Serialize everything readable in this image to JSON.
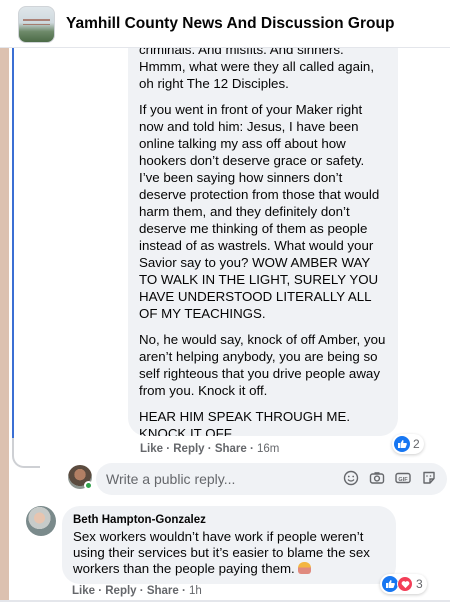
{
  "header": {
    "group_title": "Yamhill County News And Discussion Group",
    "thumb_icon": "group-cover-image"
  },
  "comment1": {
    "paragraphs": [
      "scholars say he married other OW and criminals. And misfits. And sinners. Hmmm, what were they all called again, oh right The 12 Disciples.",
      "If you went in front of your Maker right now and told him: Jesus, I have been online talking my ass off about how hookers don’t deserve grace or safety. I’ve been saying how sinners don’t deserve protection from those that would harm them, and they definitely don’t deserve me thinking of them as people instead of as wastrels. What would your Savior say to you? WOW AMBER WAY TO WALK IN THE LIGHT, SURELY YOU HAVE UNDERSTOOD LITERALLY ALL OF MY TEACHINGS.",
      "No, he would say, knock of off Amber, you aren’t helping anybody, you are being so self righteous that you drive people away from you. Knock it off.",
      "HEAR HIM SPEAK THROUGH ME. KNOCK IT OFF."
    ],
    "like_label": "Like",
    "reply_label": "Reply",
    "share_label": "Share",
    "separator": " · ",
    "time": "16m",
    "reaction_count": "2",
    "reaction_icons": [
      "like-icon"
    ]
  },
  "composer": {
    "placeholder": "Write a public reply...",
    "icons": [
      "emoji-icon",
      "camera-icon",
      "gif-icon",
      "sticker-icon"
    ]
  },
  "comment2": {
    "author": "Beth Hampton-Gonzalez",
    "text": "Sex workers wouldn’t have work if people weren’t using their services but it’s easier to blame the sex workers than the people paying them.",
    "like_label": "Like",
    "reply_label": "Reply",
    "share_label": "Share",
    "separator": " · ",
    "time": "1h",
    "reaction_count": "3",
    "reaction_icons": [
      "like-icon",
      "love-icon"
    ]
  },
  "colors": {
    "accent": "#1877f2",
    "love": "#f33e58",
    "thread": "#3b6fd4",
    "bubble": "#f0f2f5",
    "meta": "#65676b"
  }
}
